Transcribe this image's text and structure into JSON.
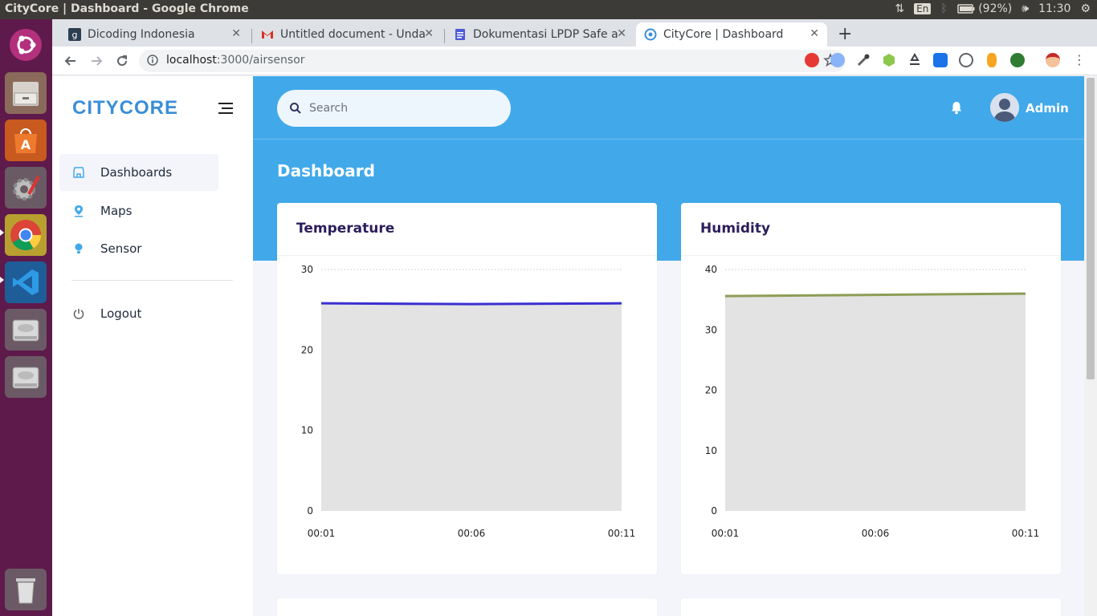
{
  "os": {
    "window_title": "CityCore | Dashboard - Google Chrome",
    "keyboard": "En",
    "battery": "(92%)",
    "clock": "11:30"
  },
  "browser": {
    "tabs": [
      {
        "label": "Dicoding Indonesia",
        "icon": "dicoding-icon"
      },
      {
        "label": "Untitled document - Unda",
        "icon": "gmail-icon"
      },
      {
        "label": "Dokumentasi LPDP Safe a",
        "icon": "docs-icon"
      },
      {
        "label": "CityCore | Dashboard",
        "icon": "citycore-icon",
        "active": true
      }
    ],
    "url_host": "localhost",
    "url_path": ":3000/airsensor"
  },
  "sidebar": {
    "logo": "CITYCORE",
    "items": [
      {
        "label": "Dashboards",
        "icon": "shop-icon",
        "active": true
      },
      {
        "label": "Maps",
        "icon": "pin-icon"
      },
      {
        "label": "Sensor",
        "icon": "bulb-icon"
      }
    ],
    "logout": "Logout"
  },
  "header": {
    "search_placeholder": "Search",
    "user_name": "Admin",
    "page_title": "Dashboard"
  },
  "colors": {
    "brand_blue": "#41a9ea",
    "temperature_line": "#3a2fd1",
    "humidity_line": "#8d9d55",
    "area_fill": "#e3e3e3"
  },
  "chart_data": [
    {
      "type": "area",
      "title": "Temperature",
      "x": [
        "00:01",
        "00:06",
        "00:11"
      ],
      "series": [
        {
          "values": [
            25.8,
            25.7,
            25.8
          ]
        }
      ],
      "ylim": [
        0,
        30
      ],
      "yticks": [
        0,
        10,
        20,
        30
      ],
      "grid": true
    },
    {
      "type": "area",
      "title": "Humidity",
      "x": [
        "00:01",
        "00:06",
        "00:11"
      ],
      "series": [
        {
          "values": [
            35.6,
            35.8,
            36.0
          ]
        }
      ],
      "ylim": [
        0,
        40
      ],
      "yticks": [
        0,
        10,
        20,
        30,
        40
      ],
      "grid": true
    }
  ]
}
